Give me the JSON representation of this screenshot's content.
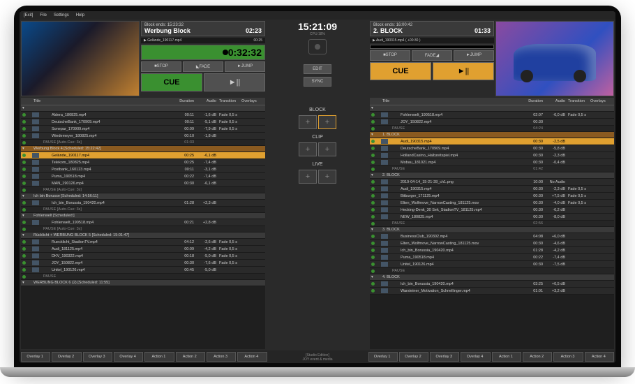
{
  "menu": {
    "exit": "[Exit]",
    "file": "File",
    "settings": "Settings",
    "help": "Help"
  },
  "clock": {
    "time": "15:21:09",
    "cpu": "CPU:18%"
  },
  "center_btns": {
    "edit": "EDIT",
    "sync": "SYNC",
    "block": "BLOCK",
    "clip": "CLIP",
    "live": "LIVE"
  },
  "left": {
    "block_ends_lbl": "Block ends:",
    "block_ends_val": "15:23:32",
    "block_name": "Werbung Block",
    "block_dur": "02:23",
    "sub1": "Gelände_190117.mp4",
    "sub2": "00:25",
    "timer": "0:32:32",
    "btns": {
      "stop": "■STOP",
      "fade": "◣FADE",
      "jump": "►JUMP",
      "cue": "CUE",
      "play": "►||"
    },
    "cols": {
      "title": "Title",
      "dur": "Duration",
      "audio": "Audio",
      "trans": "Transition",
      "over": "Overlays"
    },
    "blocks": [
      {
        "type": "blk",
        "label": ""
      },
      {
        "type": "item",
        "title": "Aldera_180825.mp4",
        "dur": "00:11",
        "audio": "-1,6 dB",
        "trans": "Fade 0,5 s"
      },
      {
        "type": "item",
        "title": "DeutscheBank_170909.mp4",
        "dur": "00:11",
        "audio": "-5,1 dB",
        "trans": "Fade 0,5 s"
      },
      {
        "type": "item",
        "title": "Sonepar_170909.mp4",
        "dur": "00:09",
        "audio": "-7,9 dB",
        "trans": "Fade 0,5 s"
      },
      {
        "type": "item",
        "title": "Wiedemeyer_180825.mp4",
        "dur": "00:10",
        "audio": "-1,8 dB",
        "trans": ""
      },
      {
        "type": "pause",
        "title": "PAUSE [Auto-Cue: 3s]",
        "dur": "01:33",
        "audio": "",
        "trans": ""
      },
      {
        "type": "blk-o",
        "label": "Werbung Block 4 [Scheduled: 15:22:42]"
      },
      {
        "type": "hi",
        "title": "Gelände_190117.mp4",
        "dur": "00:25",
        "audio": "-6,1 dB",
        "trans": ""
      },
      {
        "type": "item",
        "title": "Telekom_180825.mp4",
        "dur": "00:25",
        "audio": "-7,4 dB",
        "trans": ""
      },
      {
        "type": "item",
        "title": "Postbank_160123.mp4",
        "dur": "00:11",
        "audio": "-3,1 dB",
        "trans": ""
      },
      {
        "type": "item",
        "title": "Puma_190518.mp4",
        "dur": "00:22",
        "audio": "-7,4 dB",
        "trans": ""
      },
      {
        "type": "item",
        "title": "MAN_190126.mp4",
        "dur": "00:30",
        "audio": "-6,1 dB",
        "trans": ""
      },
      {
        "type": "pause",
        "title": "PAUSE [Auto-Cue: 3s]",
        "dur": "",
        "audio": "",
        "trans": ""
      },
      {
        "type": "blk",
        "label": "Ich bin Borusse [Scheduled: 14:56:11]"
      },
      {
        "type": "item",
        "title": "Ich_bin_Borussia_190420.mp4",
        "dur": "01:28",
        "audio": "+2,3 dB",
        "trans": ""
      },
      {
        "type": "pause",
        "title": "PAUSE [Auto-Cue: 3s]",
        "dur": "",
        "audio": "",
        "trans": ""
      },
      {
        "type": "blk",
        "label": "Fohlenwelt [Scheduled:]"
      },
      {
        "type": "item",
        "title": "Fohlenwelt_190518.mp4",
        "dur": "00:21",
        "audio": "+2,8 dB",
        "trans": ""
      },
      {
        "type": "pause",
        "title": "PAUSE [Auto-Cue: 3s]",
        "dur": "",
        "audio": "",
        "trans": ""
      },
      {
        "type": "blk",
        "label": "Rücklicht + WERBUNG BLOCK 5 [Scheduled: 15:01:47]"
      },
      {
        "type": "item",
        "title": "Ruecklicht_StadionTV.mp4",
        "dur": "04:12",
        "audio": "-2,6 dB",
        "trans": "Fade 0,5 s"
      },
      {
        "type": "item",
        "title": "Audi_181125.mp4",
        "dur": "00:09",
        "audio": "-4,2 dB",
        "trans": "Fade 0,5 s"
      },
      {
        "type": "item",
        "title": "DKV_190322.mp4",
        "dur": "00:18",
        "audio": "-5,0 dB",
        "trans": "Fade 0,5 s"
      },
      {
        "type": "item",
        "title": "JOY_150822.mp4",
        "dur": "00:30",
        "audio": "-7,6 dB",
        "trans": "Fade 0,5 s"
      },
      {
        "type": "item",
        "title": "Unitel_190126.mp4",
        "dur": "00:45",
        "audio": "-5,0 dB",
        "trans": ""
      },
      {
        "type": "pause",
        "title": "PAUSE",
        "dur": "",
        "audio": "",
        "trans": ""
      },
      {
        "type": "blk",
        "label": "WERBUNG BLOCK 6 (2) [Scheduled: 11:55]"
      }
    ]
  },
  "right": {
    "block_ends_lbl": "Block ends:",
    "block_ends_val": "16:00:42",
    "block_name": "2. BLOCK",
    "block_dur": "01:33",
    "sub1": "Audi_190315.mp4 ( +00:30 )",
    "sub2": "",
    "timer": "",
    "btns": {
      "stop": "■STOP",
      "fade": "FADE◢",
      "jump": "►JUMP",
      "cue": "CUE",
      "play": "►||"
    },
    "blocks": [
      {
        "type": "blk",
        "label": ""
      },
      {
        "type": "item",
        "title": "Fohlenwelt_190518.mp4",
        "dur": "02:07",
        "audio": "-6,0 dB",
        "trans": "Fade 0,5 s"
      },
      {
        "type": "item",
        "title": "JOY_150822.mp4",
        "dur": "00:30",
        "audio": "",
        "trans": ""
      },
      {
        "type": "pause",
        "title": "PAUSE",
        "dur": "04:24",
        "audio": "",
        "trans": ""
      },
      {
        "type": "blk-o",
        "label": "1. BLOCK"
      },
      {
        "type": "hi",
        "title": "Audi_190315.mp4",
        "dur": "00:30",
        "audio": "-2,5 dB",
        "trans": ""
      },
      {
        "type": "item",
        "title": "DeutscheBank_170909.mp4",
        "dur": "00:30",
        "audio": "-5,8 dB",
        "trans": ""
      },
      {
        "type": "item",
        "title": "HollandCasino_Halbzeitspiel.mp4",
        "dur": "00:30",
        "audio": "-2,3 dB",
        "trans": ""
      },
      {
        "type": "item",
        "title": "Mobau_181021.mp4",
        "dur": "00:30",
        "audio": "-0,4 dB",
        "trans": ""
      },
      {
        "type": "pause",
        "title": "PAUSE",
        "dur": "01:42",
        "audio": "",
        "trans": ""
      },
      {
        "type": "blk",
        "label": "2. BLOCK"
      },
      {
        "type": "item",
        "title": "2019-04-14_15-21-28_ch1.png",
        "dur": "10:00",
        "audio": "No Audio",
        "trans": ""
      },
      {
        "type": "item",
        "title": "Audi_190315.mp4",
        "dur": "00:30",
        "audio": "-2,3 dB",
        "trans": "Fade 0,5 s"
      },
      {
        "type": "item",
        "title": "Bitburger_171125.mp4",
        "dur": "00:30",
        "audio": "+7,5 dB",
        "trans": "Fade 0,5 s"
      },
      {
        "type": "item",
        "title": "Elten_Wolfmove_NarrowCasting_181125.mov",
        "dur": "00:30",
        "audio": "-4,0 dB",
        "trans": "Fade 0,5 s"
      },
      {
        "type": "item",
        "title": "Hecking-Denk_30 Sek_StadionTV_181125.mp4",
        "dur": "00:30",
        "audio": "-6,2 dB",
        "trans": ""
      },
      {
        "type": "item",
        "title": "NEW_180825.mp4",
        "dur": "00:30",
        "audio": "-8,0 dB",
        "trans": ""
      },
      {
        "type": "pause",
        "title": "PAUSE",
        "dur": "02:56",
        "audio": "",
        "trans": ""
      },
      {
        "type": "blk",
        "label": "3. BLOCK"
      },
      {
        "type": "item",
        "title": "BusinessClub_190302.mp4",
        "dur": "04:08",
        "audio": "+6,0 dB",
        "trans": ""
      },
      {
        "type": "item",
        "title": "Elten_Wolfmove_NarrowCasting_181125.mov",
        "dur": "00:30",
        "audio": "-4,6 dB",
        "trans": ""
      },
      {
        "type": "item",
        "title": "Ich_bin_Borussia_190420.mp4",
        "dur": "01:28",
        "audio": "-4,2 dB",
        "trans": ""
      },
      {
        "type": "item",
        "title": "Puma_190518.mp4",
        "dur": "00:22",
        "audio": "-7,4 dB",
        "trans": ""
      },
      {
        "type": "item",
        "title": "Unitel_190126.mp4",
        "dur": "00:30",
        "audio": "-7,5 dB",
        "trans": ""
      },
      {
        "type": "pause",
        "title": "PAUSE",
        "dur": "",
        "audio": "",
        "trans": ""
      },
      {
        "type": "blk",
        "label": "4. BLOCK"
      },
      {
        "type": "item",
        "title": "Ich_bin_Borussia_190420.mp4",
        "dur": "03:25",
        "audio": "+0,5 dB",
        "trans": ""
      },
      {
        "type": "item",
        "title": "Warsteiner_Motivation_Schnellinger.mp4",
        "dur": "01:01",
        "audio": "+3,2 dB",
        "trans": ""
      }
    ]
  },
  "bottom": {
    "overlays": [
      "Overlay 1",
      "Overlay 2",
      "Overlay 3",
      "Overlay 4"
    ],
    "actions": [
      "Action 1",
      "Action 2",
      "Action 3",
      "Action 4"
    ],
    "edition": "[Studio Edition]",
    "brand": "JOY event & media"
  }
}
